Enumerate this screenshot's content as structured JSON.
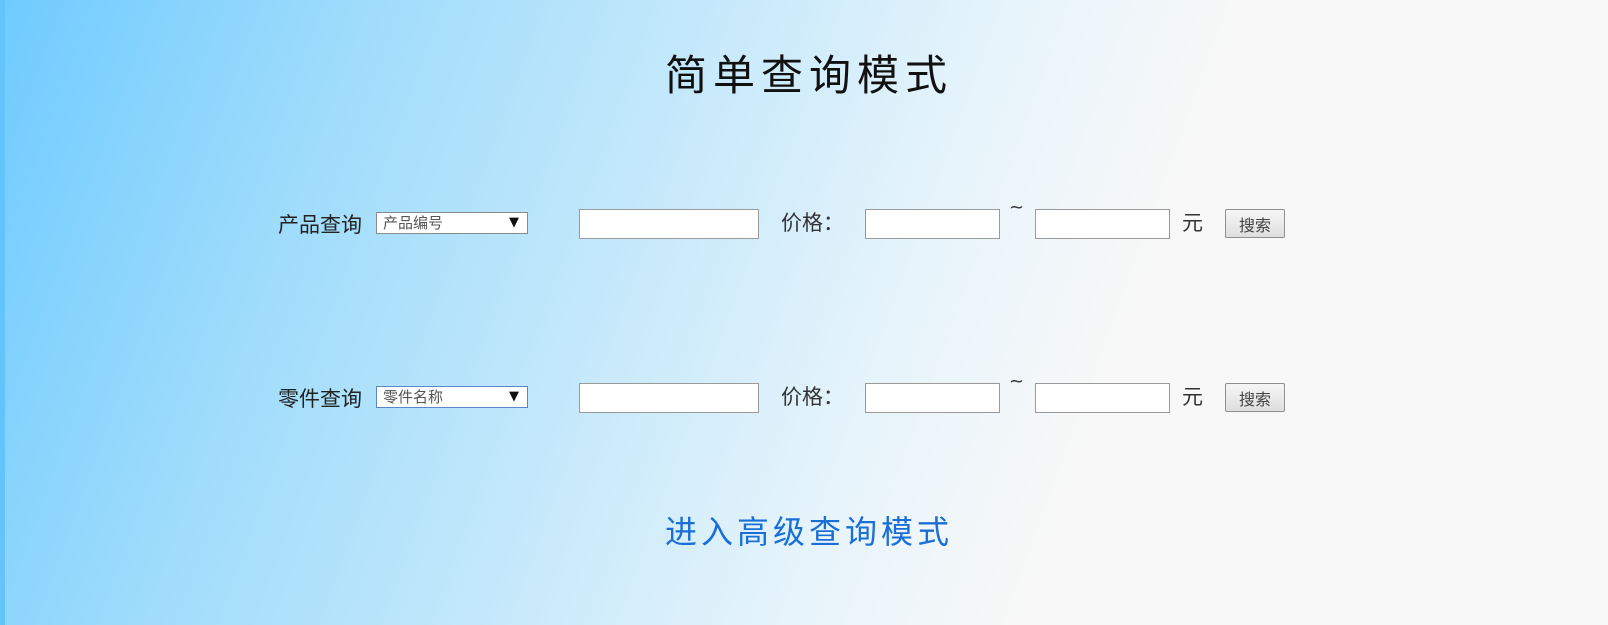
{
  "page": {
    "title": "简单查询模式"
  },
  "product_query": {
    "label": "产品查询",
    "select_value": "产品编号",
    "keyword_value": "",
    "price_label": "价格：",
    "min_price": "",
    "range_separator": "~",
    "max_price": "",
    "unit": "元",
    "search_label": "搜索"
  },
  "part_query": {
    "label": "零件查询",
    "select_value": "零件名称",
    "keyword_value": "",
    "price_label": "价格：",
    "min_price": "",
    "range_separator": "~",
    "max_price": "",
    "unit": "元",
    "search_label": "搜索"
  },
  "advanced_link": {
    "label": "进入高级查询模式"
  },
  "icons": {
    "dropdown": "dropdown-arrow-icon"
  },
  "colors": {
    "link": "#1a6fd6",
    "gradient_start": "#6fcbff",
    "gradient_end": "#f8f8f8"
  }
}
